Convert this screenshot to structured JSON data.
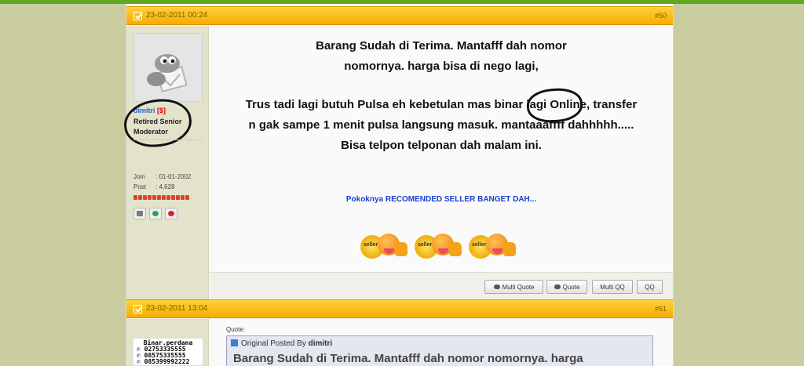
{
  "posts": [
    {
      "date": "23-02-2011 00:24",
      "number": "#50",
      "user": {
        "name": "dimitri",
        "tag": "[$]",
        "rank": "Retired Senior Moderator",
        "join_label": "Join",
        "join_value": ": 01-01-2002",
        "post_label": "Post",
        "post_value": ": 4,628"
      },
      "content_lines_1": "Barang Sudah di Terima. Mantafff dah nomor nomornya. harga bisa di nego lagi,",
      "content_lines_2": "Trus tadi lagi butuh Pulsa eh kebetulan mas binar lagi Online, transfer n gak sampe 1 menit pulsa langsung masuk. mantaaaffff dahhhhh..... Bisa telpon telponan dah malam ini.",
      "recommend": "Pokoknya RECOMENDED SELLER BANGET DAH...",
      "smiley_label": "seller",
      "buttons": {
        "multi_quote": "Multi Quote",
        "quote": "Quote",
        "multi_qq": "Multi QQ",
        "qq": "QQ"
      }
    },
    {
      "date": "23-02-2011 13:04",
      "number": "#51",
      "sig_lines": [
        "Binar.perdana",
        "02753335555",
        "08575335555",
        "085399992222"
      ],
      "quote_label": "Quote:",
      "quote_prefix": "Original Posted By",
      "quote_author": "dimitri",
      "quote_text": "Barang Sudah di Terima. Mantafff dah nomor nomornya. harga"
    }
  ],
  "colors": {
    "header": "#f5ad00",
    "link": "#2266cc",
    "recommend": "#1a3fd0",
    "page_bg": "#c9cc9f"
  }
}
